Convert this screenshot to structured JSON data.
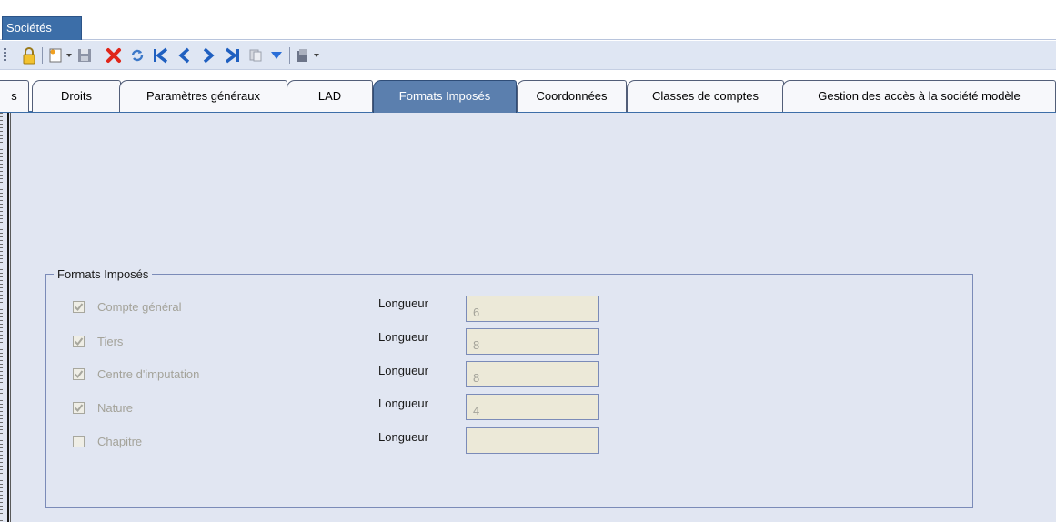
{
  "window": {
    "tab_label": "Sociétés"
  },
  "toolbar": {
    "icons": [
      "lock-icon",
      "new-document-icon",
      "dropdown-arrow-icon",
      "save-icon",
      "delete-icon",
      "refresh-icon",
      "first-record-icon",
      "previous-record-icon",
      "next-record-icon",
      "last-record-icon",
      "copy-icon",
      "menu-dropdown-icon",
      "print-icon",
      "dropdown-arrow-icon"
    ]
  },
  "tabs": [
    {
      "label": "s",
      "active": false
    },
    {
      "label": "Droits",
      "active": false
    },
    {
      "label": "Paramètres généraux",
      "active": false
    },
    {
      "label": "LAD",
      "active": false
    },
    {
      "label": "Formats Imposés",
      "active": true
    },
    {
      "label": "Coordonnées",
      "active": false
    },
    {
      "label": "Classes de comptes",
      "active": false
    },
    {
      "label": "Gestion des accès à la société modèle",
      "active": false
    }
  ],
  "group": {
    "title": "Formats Imposés",
    "rows": [
      {
        "checkbox_label": "Compte général",
        "checked": true,
        "length_label": "Longueur",
        "length_value": "6"
      },
      {
        "checkbox_label": "Tiers",
        "checked": true,
        "length_label": "Longueur",
        "length_value": "8"
      },
      {
        "checkbox_label": "Centre d'imputation",
        "checked": true,
        "length_label": "Longueur",
        "length_value": "8"
      },
      {
        "checkbox_label": "Nature",
        "checked": true,
        "length_label": "Longueur",
        "length_value": "4"
      },
      {
        "checkbox_label": "Chapitre",
        "checked": false,
        "length_label": "Longueur",
        "length_value": ""
      }
    ]
  },
  "colors": {
    "accent": "#3c6ea8",
    "active_tab": "#5b7fae",
    "panel_bg": "#e1e6f2",
    "disabled_text": "#a4a39a"
  }
}
